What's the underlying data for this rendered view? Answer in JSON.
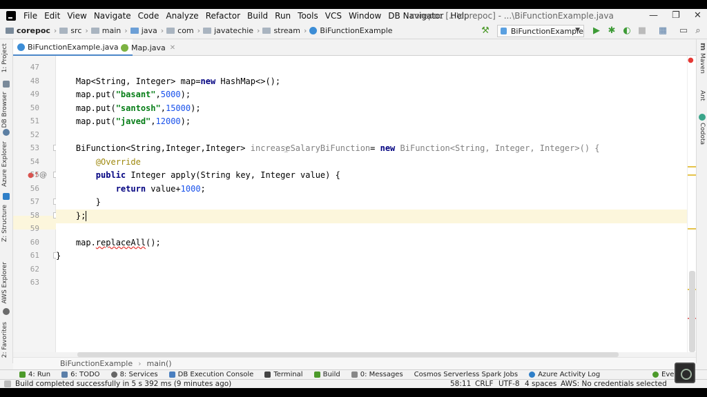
{
  "menu": [
    "File",
    "Edit",
    "View",
    "Navigate",
    "Code",
    "Analyze",
    "Refactor",
    "Build",
    "Run",
    "Tools",
    "VCS",
    "Window",
    "DB Navigator",
    "Help"
  ],
  "window_title": "corepoc [...\\corepoc] - ...\\BiFunctionExample.java",
  "window_controls": {
    "minimize": "—",
    "maximize": "❐",
    "close": "✕"
  },
  "breadcrumbs": [
    "corepoc",
    "src",
    "main",
    "java",
    "com",
    "javatechie",
    "stream",
    "BiFunctionExample"
  ],
  "run_config": "BiFunctionExample",
  "left_tools": [
    "1: Project",
    "DB Browser",
    "Azure Explorer",
    "Z: Structure",
    "AWS Explorer",
    "2: Favorites"
  ],
  "right_tools": [
    "Maven",
    "Ant",
    "Codota"
  ],
  "tabs": [
    {
      "label": "BiFunctionExample.java",
      "active": true
    },
    {
      "label": "Map.java",
      "active": false
    }
  ],
  "line_numbers": [
    "47",
    "48",
    "49",
    "50",
    "51",
    "52",
    "53",
    "54",
    "55",
    "56",
    "57",
    "58",
    "59",
    "60",
    "61",
    "62",
    "63"
  ],
  "code": {
    "l48": {
      "a": "    Map<String, Integer> map=",
      "kw": "new",
      "b": " HashMap<>();"
    },
    "l49": {
      "a": "    map.put(",
      "s": "\"basant\"",
      "c": ",",
      "n": "5000",
      "d": ");"
    },
    "l50": {
      "a": "    map.put(",
      "s": "\"santosh\"",
      "c": ",",
      "n": "15000",
      "d": ");"
    },
    "l51": {
      "a": "    map.put(",
      "s": "\"javed\"",
      "c": ",",
      "n": "12000",
      "d": ");"
    },
    "l53": {
      "a": "    BiFunction<String,Integer,Integer> ",
      "v": "increaseSalaryBiFunction",
      "e": "= ",
      "kw": "new",
      "f": " BiFunction<String, Integer, Integer>() {"
    },
    "l54": {
      "a": "        ",
      "ann": "@Override"
    },
    "l55": {
      "a": "        ",
      "kw": "public",
      "b": " Integer apply(String key, Integer value) {"
    },
    "l56": {
      "a": "            ",
      "kw": "return",
      "b": " value+",
      "n": "1000",
      "c": ";"
    },
    "l57": {
      "a": "        }"
    },
    "l58": {
      "a": "    };"
    },
    "l60": {
      "a": "    map.",
      "err": "replaceAll",
      "b": "();"
    },
    "l61": {
      "a": "}"
    }
  },
  "editor_breadcrumb": [
    "BiFunctionExample",
    "main()"
  ],
  "tool_windows": [
    "4: Run",
    "6: TODO",
    "8: Services",
    "DB Execution Console",
    "Terminal",
    "Build",
    "0: Messages",
    "Cosmos Serverless Spark Jobs",
    "Azure Activity Log",
    "Even"
  ],
  "status": {
    "message": "Build completed successfully in 5 s 392 ms (9 minutes ago)",
    "position": "58:11",
    "line_sep": "CRLF",
    "encoding": "UTF-8",
    "indent": "4 spaces",
    "aws": "AWS: No credentials selected"
  },
  "colors": {
    "keyword": "#000080",
    "string": "#067d17",
    "number": "#1750eb",
    "annotation": "#9e880d",
    "highlight": "#fcf6dc"
  }
}
